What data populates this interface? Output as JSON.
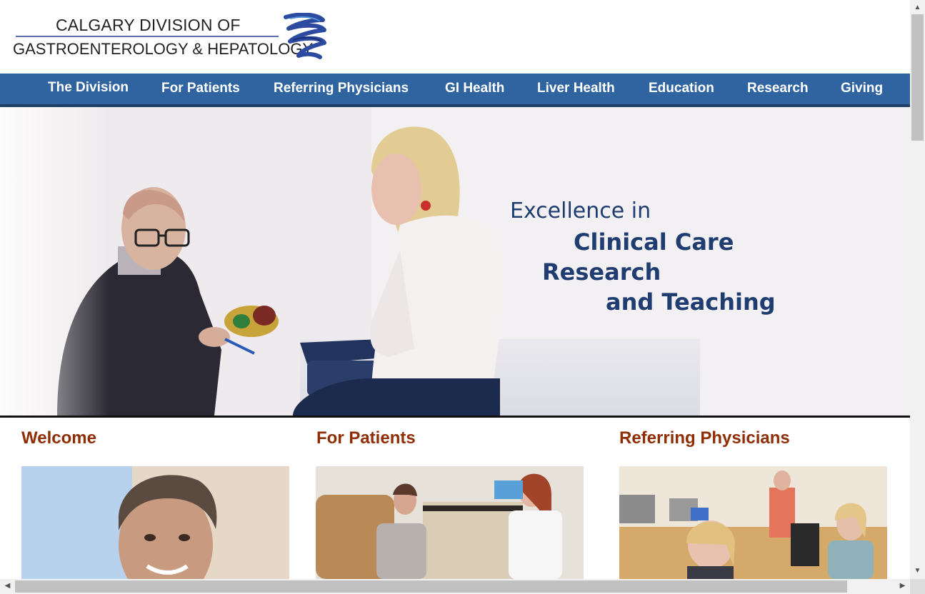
{
  "logo": {
    "line1": "CALGARY DIVISION OF",
    "line2": "GASTROENTEROLOGY & HEPATOLOGY"
  },
  "nav": {
    "items": [
      "The Division",
      "For Patients",
      "Referring Physicians",
      "GI Health",
      "Liver Health",
      "Education",
      "Research",
      "Giving"
    ]
  },
  "hero": {
    "line1": "Excellence in",
    "line2": "Clinical Care",
    "line3": "Research",
    "line4": "and Teaching"
  },
  "columns": [
    {
      "title": "Welcome"
    },
    {
      "title": "For Patients"
    },
    {
      "title": "Referring Physicians"
    }
  ],
  "colors": {
    "nav_bg": "#2f64a0",
    "section_title": "#8f2e05",
    "hero_text": "#1f3d70"
  }
}
